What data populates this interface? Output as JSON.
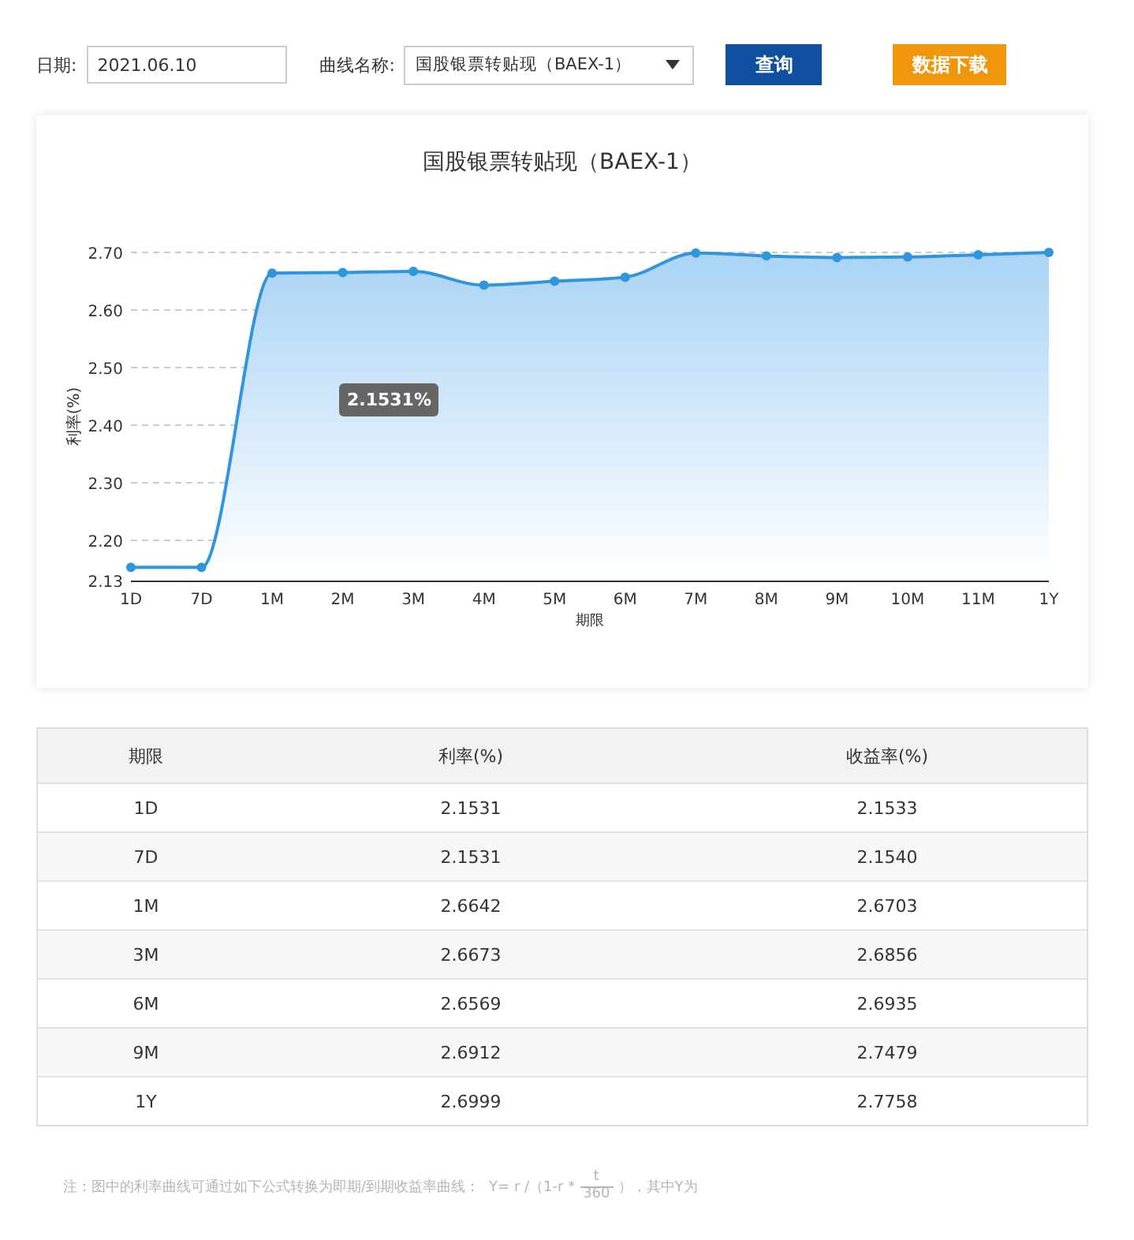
{
  "filters": {
    "date_label": "日期:",
    "date_value": "2021.06.10",
    "curve_label": "曲线名称:",
    "curve_value": "国股银票转贴现（BAEX-1）",
    "query_button": "查询",
    "download_button": "数据下载"
  },
  "chart": {
    "title": "国股银票转贴现（BAEX-1）",
    "tooltip": "2.1531%",
    "chart_data": {
      "type": "line",
      "xlabel": "期限",
      "ylabel": "利率(%)",
      "categories": [
        "1D",
        "7D",
        "1M",
        "2M",
        "3M",
        "4M",
        "5M",
        "6M",
        "7M",
        "8M",
        "9M",
        "10M",
        "11M",
        "1Y"
      ],
      "series": [
        {
          "color": "#2f95dc",
          "marker": "circle",
          "values": [
            2.153,
            2.153,
            2.664,
            2.665,
            2.667,
            2.643,
            2.65,
            2.657,
            2.699,
            2.694,
            2.691,
            2.692,
            2.696,
            2.7
          ]
        }
      ],
      "grid": true,
      "ylim": [
        2.13,
        2.7
      ],
      "yticks": [
        2.13,
        {
          "value": 2.2,
          "label": "2.20"
        },
        {
          "value": 2.3,
          "label": "2.30"
        },
        {
          "value": 2.4,
          "label": "2.40"
        },
        {
          "value": 2.5,
          "label": "2.50"
        },
        {
          "value": 2.6,
          "label": "2.60"
        },
        {
          "value": 2.7,
          "label": "2.70"
        }
      ]
    }
  },
  "table": {
    "columns": [
      "期限",
      "利率(%)",
      "收益率(%)"
    ],
    "rows": [
      [
        "1D",
        "2.1531",
        "2.1533"
      ],
      [
        "7D",
        "2.1531",
        "2.1540"
      ],
      [
        "1M",
        "2.6642",
        "2.6703"
      ],
      [
        "3M",
        "2.6673",
        "2.6856"
      ],
      [
        "6M",
        "2.6569",
        "2.6935"
      ],
      [
        "9M",
        "2.6912",
        "2.7479"
      ],
      [
        "1Y",
        "2.6999",
        "2.7758"
      ]
    ]
  },
  "note": {
    "text": "注：图中的利率曲线可通过如下公式转换为即期/到期收益率曲线：",
    "formula": "Y= r /（1-r *",
    "numerator": "t",
    "denominator": "360",
    "formula_end": "），",
    "after": "其中Y为"
  }
}
